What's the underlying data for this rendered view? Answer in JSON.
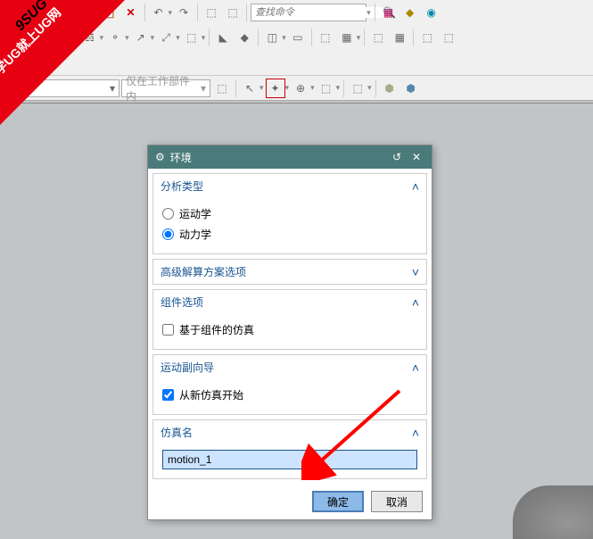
{
  "search": {
    "placeholder": "查找命令"
  },
  "filter": {
    "combo2": "仅在工作部件内"
  },
  "banner": {
    "line1": "9SUG",
    "line2": "学UG就上UG网"
  },
  "dialog": {
    "title": "环境",
    "s1": {
      "title": "分析类型",
      "opt1": "运动学",
      "opt2": "动力学"
    },
    "s2": {
      "title": "高级解算方案选项"
    },
    "s3": {
      "title": "组件选项",
      "opt1": "基于组件的仿真"
    },
    "s4": {
      "title": "运动副向导",
      "opt1": "从新仿真开始"
    },
    "s5": {
      "title": "仿真名",
      "value": "motion_1"
    },
    "ok": "确定",
    "cancel": "取消"
  }
}
